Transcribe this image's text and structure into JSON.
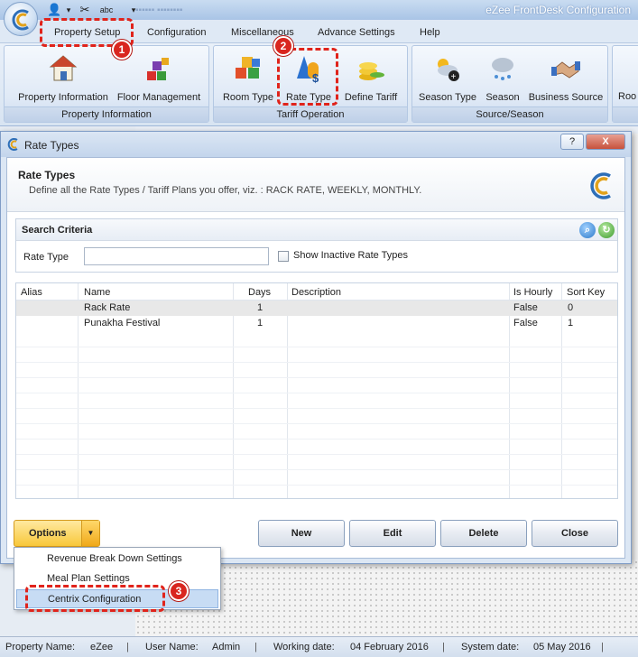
{
  "app": {
    "title": "eZee FrontDesk Configuration"
  },
  "menu": {
    "items": [
      "Property Setup",
      "Configuration",
      "Miscellaneous",
      "Advance Settings",
      "Help"
    ]
  },
  "ribbon": {
    "groups": [
      {
        "label": "Property Information",
        "buttons": [
          "Property Information",
          "Floor Management"
        ]
      },
      {
        "label": "Tariff Operation",
        "buttons": [
          "Room Type",
          "Rate Type",
          "Define Tariff"
        ]
      },
      {
        "label": "Source/Season",
        "buttons": [
          "Season Type",
          "Season",
          "Business Source"
        ]
      }
    ],
    "overflow_label": "Roo"
  },
  "dialog": {
    "title": "Rate Types",
    "header_title": "Rate Types",
    "header_desc": "Define all the Rate Types / Tariff Plans you offer, viz. :  RACK RATE, WEEKLY, MONTHLY.",
    "help_button": "?",
    "close_x": "X",
    "search": {
      "title": "Search Criteria",
      "rate_type_label": "Rate Type",
      "rate_type_value": "",
      "inactive_label": "Show Inactive Rate Types"
    },
    "grid": {
      "columns": [
        "Alias",
        "Name",
        "Days",
        "Description",
        "Is Hourly",
        "Sort Key"
      ],
      "rows": [
        {
          "alias": "",
          "name": "Rack Rate",
          "days": "1",
          "description": "",
          "is_hourly": "False",
          "sort_key": "0"
        },
        {
          "alias": "",
          "name": "Punakha Festival",
          "days": "1",
          "description": "",
          "is_hourly": "False",
          "sort_key": "1"
        }
      ]
    },
    "buttons": {
      "options": "Options",
      "new": "New",
      "edit": "Edit",
      "delete": "Delete",
      "close": "Close"
    }
  },
  "options_menu": {
    "items": [
      "Revenue Break Down Settings",
      "Meal Plan Settings",
      "Centrix Configuration"
    ]
  },
  "annotations": [
    "1",
    "2",
    "3"
  ],
  "status": {
    "property_name_label": "Property Name:",
    "property_name": "eZee",
    "user_name_label": "User Name:",
    "user_name": "Admin",
    "working_date_label": "Working date:",
    "working_date": "04 February 2016",
    "system_date_label": "System date:",
    "system_date": "05 May 2016"
  },
  "colors": {
    "highlight": "#e0231b",
    "options_button": "#f8c83a",
    "selected_menu": "#c7dcf4"
  }
}
